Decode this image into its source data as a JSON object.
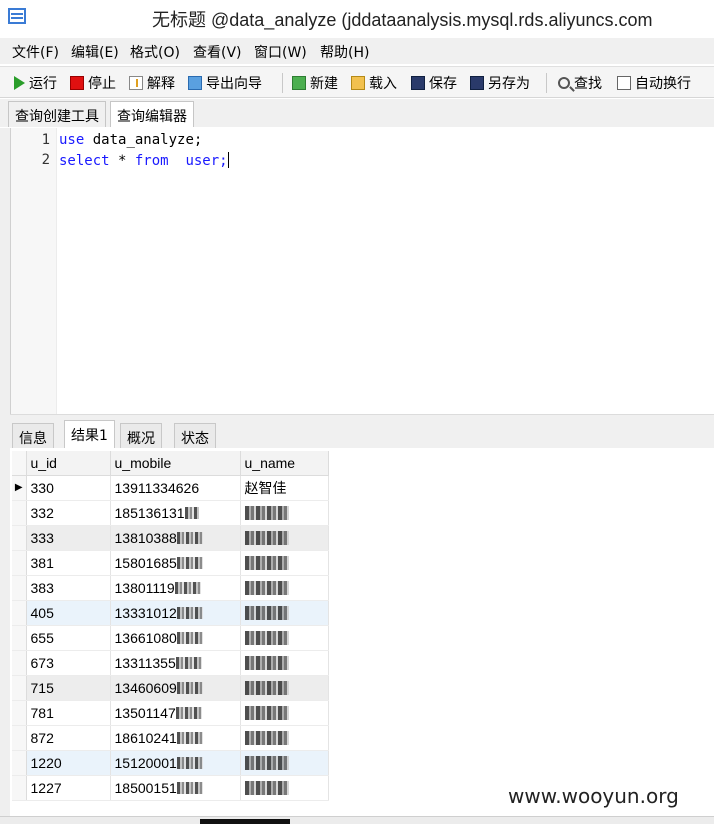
{
  "window": {
    "title": "无标题 @data_analyze (jddataanalysis.mysql.rds.aliyuncs.com"
  },
  "menubar": {
    "items": [
      "文件(F)",
      "编辑(E)",
      "格式(O)",
      "查看(V)",
      "窗口(W)",
      "帮助(H)"
    ]
  },
  "toolbar": {
    "run": "运行",
    "stop": "停止",
    "explain": "解释",
    "export_wizard": "导出向导",
    "new": "新建",
    "load": "载入",
    "save": "保存",
    "save_as": "另存为",
    "find": "查找",
    "auto_wrap": "自动换行"
  },
  "subtabs": {
    "query_builder": "查询创建工具",
    "query_editor": "查询编辑器"
  },
  "editor": {
    "lines": [
      {
        "no": "1",
        "kw": "use",
        "rest": " data_analyze;"
      },
      {
        "no": "2",
        "kw": "select",
        "mid": " * ",
        "kw2": "from",
        "rest": "  user;"
      }
    ]
  },
  "result_tabs": [
    "信息",
    "结果1",
    "概况",
    "状态"
  ],
  "grid": {
    "headers": [
      "u_id",
      "u_mobile",
      "u_name"
    ],
    "rows": [
      {
        "id": "330",
        "mobile": "13911334626",
        "name": "赵智佳"
      },
      {
        "id": "332",
        "mobile": "185136131",
        "name": ""
      },
      {
        "id": "333",
        "mobile": "13810388",
        "name": ""
      },
      {
        "id": "381",
        "mobile": "15801685",
        "name": ""
      },
      {
        "id": "383",
        "mobile": "13801119",
        "name": ""
      },
      {
        "id": "405",
        "mobile": "13331012",
        "name": ""
      },
      {
        "id": "655",
        "mobile": "13661080",
        "name": ""
      },
      {
        "id": "673",
        "mobile": "13311355",
        "name": ""
      },
      {
        "id": "715",
        "mobile": "13460609",
        "name": ""
      },
      {
        "id": "781",
        "mobile": "13501147",
        "name": ""
      },
      {
        "id": "872",
        "mobile": "18610241",
        "name": ""
      },
      {
        "id": "1220",
        "mobile": "15120001",
        "name": ""
      },
      {
        "id": "1227",
        "mobile": "18500151",
        "name": ""
      }
    ]
  },
  "watermark": "www.wooyun.org"
}
